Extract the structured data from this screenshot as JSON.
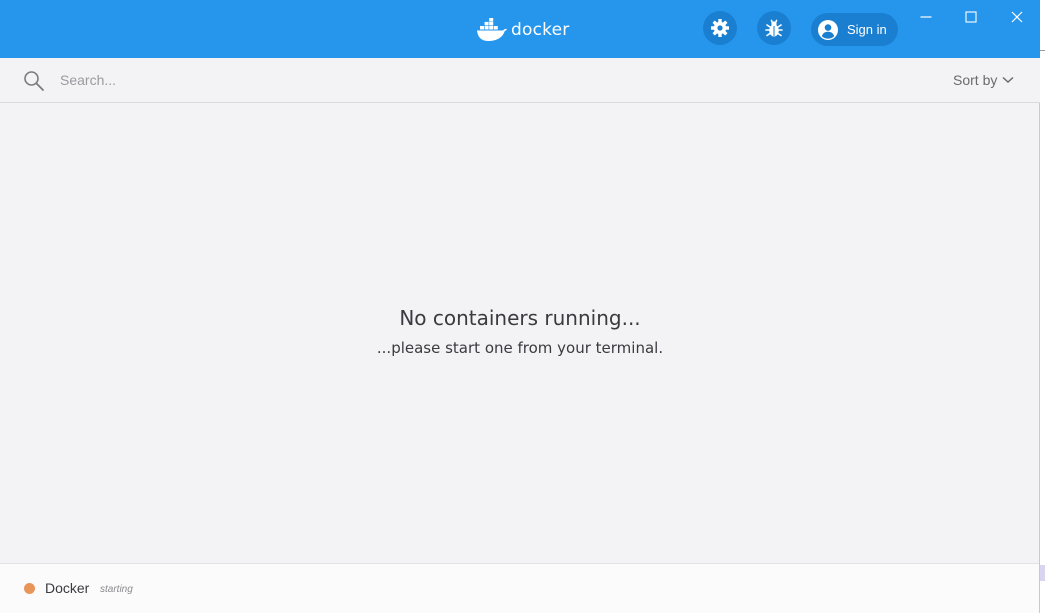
{
  "app": {
    "brand_text": "docker",
    "accent_color": "#2596ec"
  },
  "header": {
    "settings_icon": "gear-icon",
    "bug_icon": "bug-icon",
    "signin_label": "Sign in",
    "signin_icon": "user-avatar-icon"
  },
  "window_controls": {
    "minimize": "minimize-icon",
    "maximize": "maximize-icon",
    "close": "close-icon"
  },
  "search": {
    "placeholder": "Search...",
    "value": "",
    "sort_label": "Sort by"
  },
  "empty_state": {
    "title": "No containers running...",
    "subtitle": "...please start one from your terminal."
  },
  "status": {
    "name": "Docker",
    "state": "starting",
    "dot_color": "#e8955a"
  }
}
